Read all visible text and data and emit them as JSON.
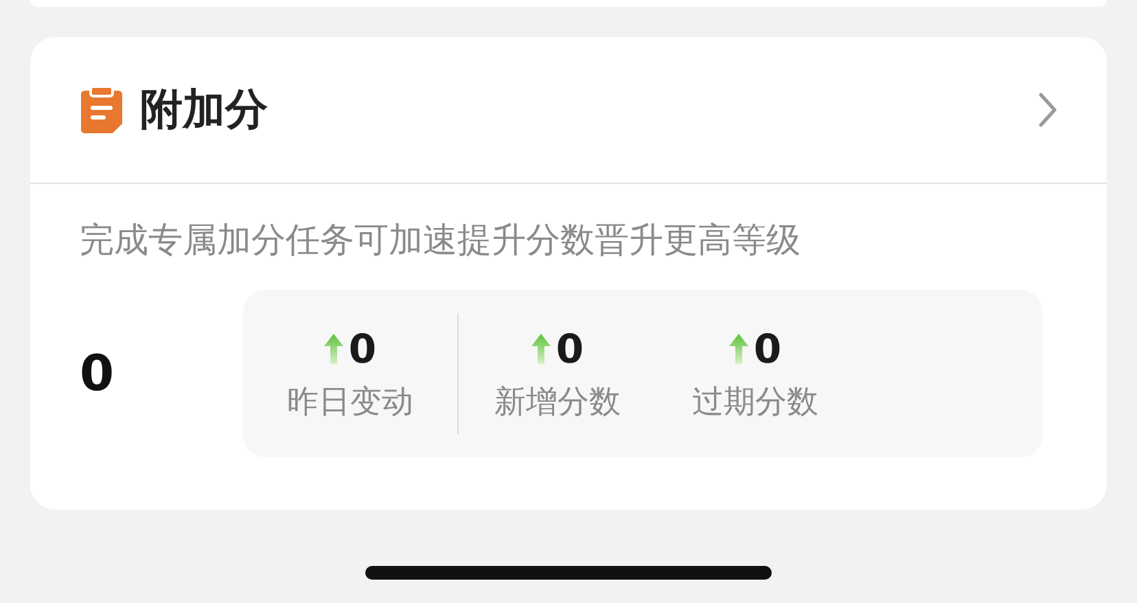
{
  "card": {
    "title": "附加分",
    "description": "完成专属加分任务可加速提升分数晋升更高等级",
    "score": "0",
    "stats": [
      {
        "value": "0",
        "label": "昨日变动"
      },
      {
        "value": "0",
        "label": "新增分数"
      },
      {
        "value": "0",
        "label": "过期分数"
      }
    ]
  }
}
